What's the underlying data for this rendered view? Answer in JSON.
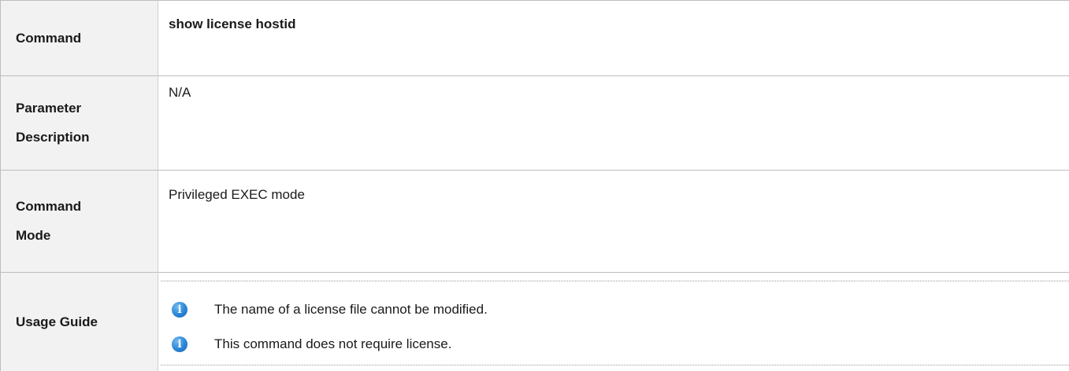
{
  "rows": [
    {
      "label": "Command",
      "content": "show license hostid"
    },
    {
      "label_lines": [
        "Parameter",
        "Description"
      ],
      "content": "N/A"
    },
    {
      "label_lines": [
        "Command",
        "Mode"
      ],
      "content": "Privileged EXEC mode"
    },
    {
      "label": "Usage Guide",
      "notes": [
        {
          "icon": "info-icon",
          "text": "The name of a license file cannot be modified."
        },
        {
          "icon": "info-icon",
          "text": "This command does not require license."
        }
      ]
    }
  ],
  "colors": {
    "label_background": "#f2f2f2",
    "border": "#bdbdbd",
    "info_icon": "#2a86d6"
  }
}
